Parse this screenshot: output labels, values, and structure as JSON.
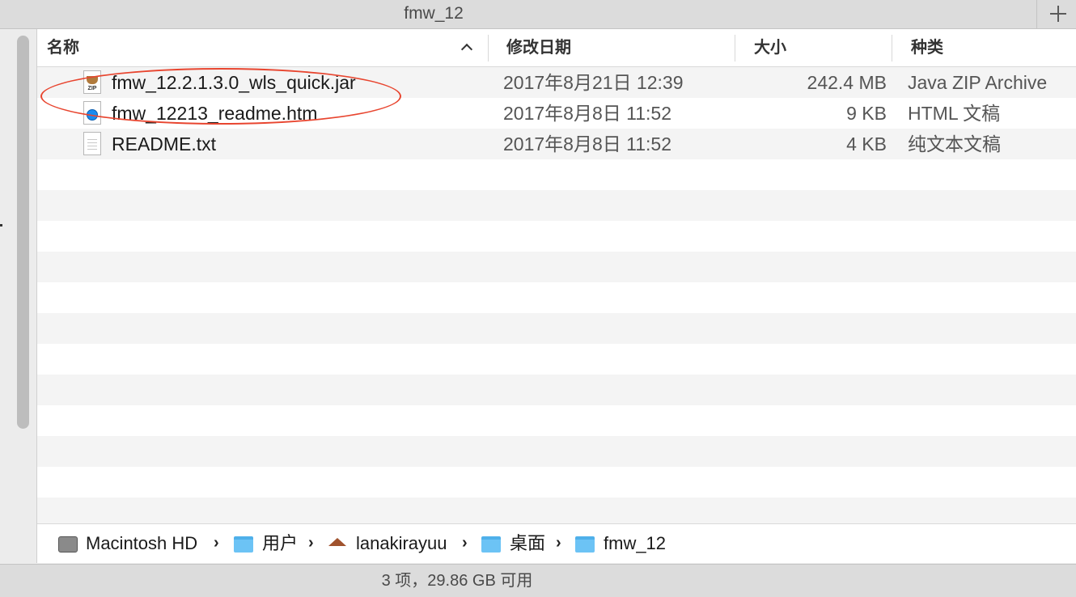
{
  "window": {
    "tab_title": "fmw_12"
  },
  "columns": {
    "name": "名称",
    "date": "修改日期",
    "size": "大小",
    "kind": "种类"
  },
  "files": [
    {
      "name": "fmw_12.2.1.3.0_wls_quick.jar",
      "date": "2017年8月21日 12:39",
      "size": "242.4 MB",
      "kind": "Java ZIP Archive",
      "icon": "jar-file-icon"
    },
    {
      "name": "fmw_12213_readme.htm",
      "date": "2017年8月8日 11:52",
      "size": "9 KB",
      "kind": "HTML 文稿",
      "icon": "html-file-icon"
    },
    {
      "name": "README.txt",
      "date": "2017年8月8日 11:52",
      "size": "4 KB",
      "kind": "纯文本文稿",
      "icon": "text-file-icon"
    }
  ],
  "path": [
    {
      "label": "Macintosh HD",
      "icon": "hard-drive-icon"
    },
    {
      "label": "用户",
      "icon": "users-folder-icon"
    },
    {
      "label": "lanakirayuu",
      "icon": "home-icon"
    },
    {
      "label": "桌面",
      "icon": "desktop-folder-icon"
    },
    {
      "label": "fmw_12",
      "icon": "folder-icon"
    }
  ],
  "status": {
    "text": "3 项，29.86 GB 可用"
  },
  "colors": {
    "highlight": "#e8452f",
    "folder": "#6cc3f5"
  }
}
